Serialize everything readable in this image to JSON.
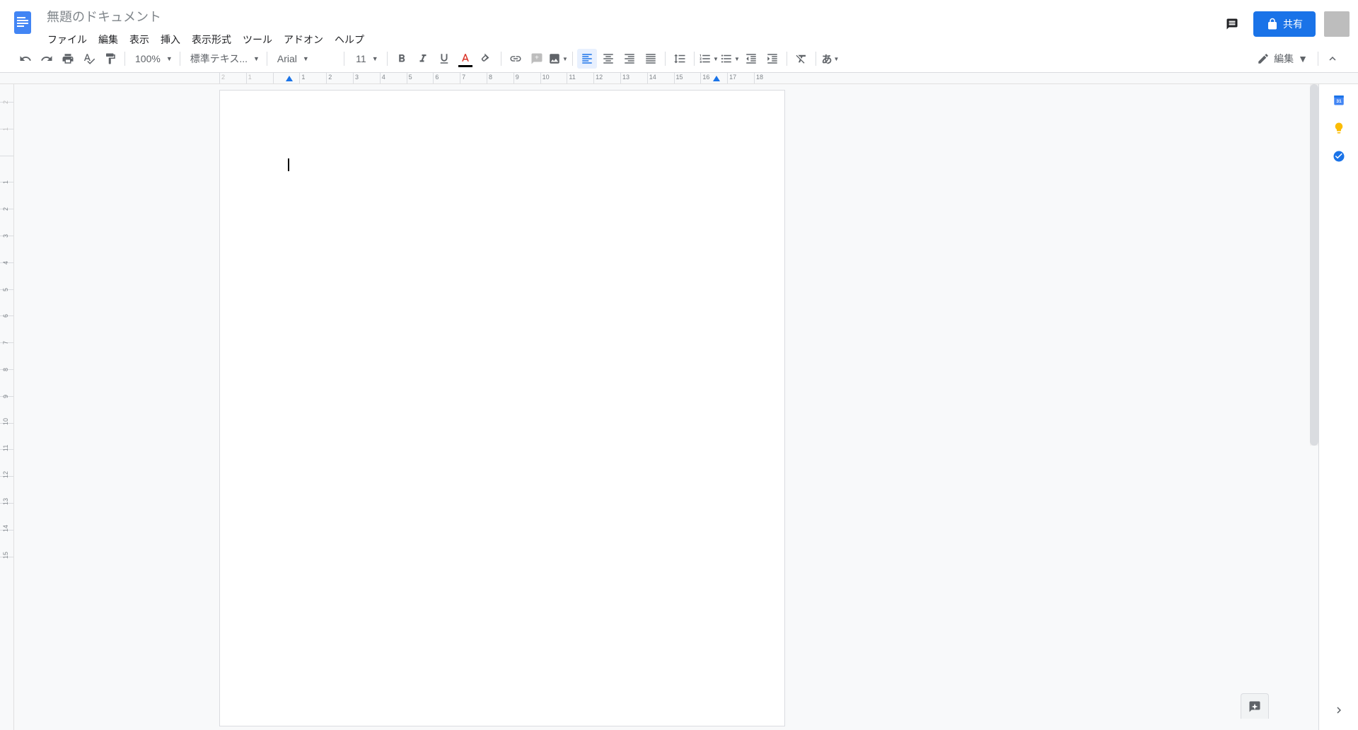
{
  "doc_title": "無題のドキュメント",
  "menubar": {
    "file": "ファイル",
    "edit": "編集",
    "view": "表示",
    "insert": "挿入",
    "format": "表示形式",
    "tools": "ツール",
    "addons": "アドオン",
    "help": "ヘルプ"
  },
  "share_label": "共有",
  "toolbar": {
    "zoom": "100%",
    "style": "標準テキス...",
    "font": "Arial",
    "font_size": "11",
    "edit_mode": "編集"
  },
  "ruler_h": [
    "2",
    "1",
    "",
    "1",
    "2",
    "3",
    "4",
    "5",
    "6",
    "7",
    "8",
    "9",
    "10",
    "11",
    "12",
    "13",
    "14",
    "15",
    "16",
    "17",
    "18"
  ],
  "ruler_v": [
    "2",
    "1",
    "",
    "1",
    "2",
    "3",
    "4",
    "5",
    "6",
    "7",
    "8",
    "9",
    "10",
    "11",
    "12",
    "13",
    "14",
    "15"
  ],
  "side_calendar_day": "31"
}
